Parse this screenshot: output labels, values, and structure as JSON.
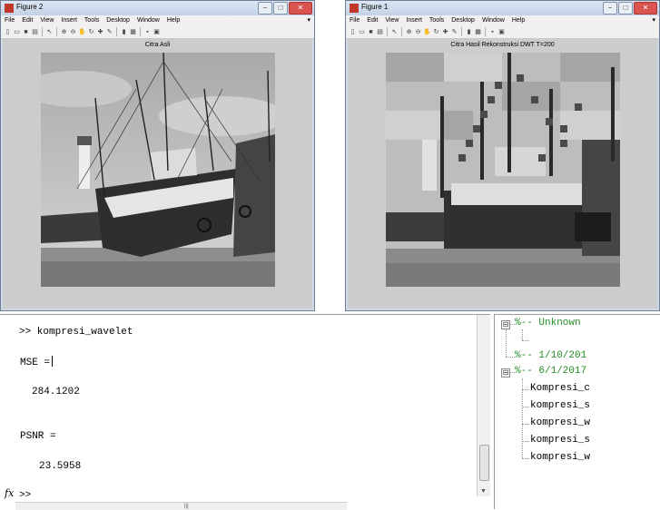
{
  "figure2": {
    "title": "Figure 2",
    "axes_title": "Citra Asli",
    "menu": [
      "File",
      "Edit",
      "View",
      "Insert",
      "Tools",
      "Desktop",
      "Window",
      "Help"
    ],
    "window_buttons": {
      "minimize": "−",
      "maximize": "□",
      "close": "✕"
    },
    "menu_arrow": "▾"
  },
  "figure1": {
    "title": "Figure 1",
    "axes_title": "Citra Hasil Rekonstruksi DWT T=200",
    "menu": [
      "File",
      "Edit",
      "View",
      "Insert",
      "Tools",
      "Desktop",
      "Window",
      "Help"
    ],
    "window_buttons": {
      "minimize": "−",
      "maximize": "□",
      "close": "✕"
    },
    "menu_arrow": "▾"
  },
  "toolbar_icons": [
    "new-file-icon",
    "open-folder-icon",
    "save-icon",
    "print-icon",
    "pointer-icon",
    "zoom-in-icon",
    "zoom-out-icon",
    "pan-icon",
    "rotate-icon",
    "data-cursor-icon",
    "brush-icon",
    "link-icon",
    "colorbar-icon",
    "legend-icon",
    "hide-plot-tools-icon",
    "show-plot-tools-icon"
  ],
  "command_window": {
    "lines": [
      ">> kompresi_wavelet",
      "MSE =",
      "284.1202",
      "PSNR =",
      "23.5958",
      ">>"
    ],
    "fx_symbol": "fx"
  },
  "command_history": {
    "groups": [
      {
        "label": "%-- Unknown",
        "items": []
      },
      {
        "label": "%-- 1/10/201",
        "items": []
      },
      {
        "label": "%-- 6/1/2017",
        "items": [
          "Kompresi_c",
          "kompresi_s",
          "kompresi_w",
          "kompresi_s",
          "kompresi_w"
        ]
      }
    ],
    "expander_collapsed": "⊟"
  },
  "colors": {
    "titlebar": "#c3d2e6",
    "figure_background": "#cccccc",
    "history_group": "#228b22"
  }
}
